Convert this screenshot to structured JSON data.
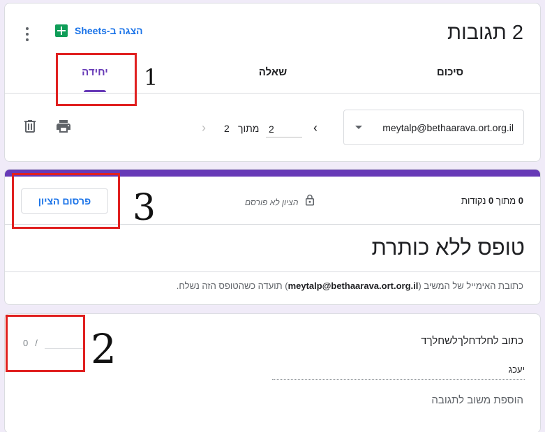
{
  "header": {
    "title": "2 תגובות",
    "sheets_link": "הצגה ב-Sheets"
  },
  "tabs": [
    {
      "label": "סיכום"
    },
    {
      "label": "שאלה"
    },
    {
      "label": "יחידה"
    }
  ],
  "respondent": {
    "email": "meytalp@bethaarava.ort.org.il"
  },
  "pager": {
    "current": "2",
    "of_label": "מתוך",
    "total": "2"
  },
  "form": {
    "points_prefix": "0",
    "points_mid": "מתוך",
    "points_total": "0",
    "points_suffix": "נקודות",
    "grade_status": "הציון לא פורסם",
    "publish_label": "פרסום הציון",
    "title": "טופס ללא כותרת",
    "email_note_prefix": "כתובת האימייל של המשיב (",
    "email_note_email": "meytalp@bethaarava.ort.org.il",
    "email_note_suffix": ") תועדה כשהטופס הזה נשלח."
  },
  "question": {
    "title": "כתוב לחלדחלךלשחלךד",
    "score_separator": "/",
    "score_max": "0",
    "answer": "יעכג",
    "feedback_label": "הוספת משוב לתגובה"
  },
  "annotations": {
    "mark_1": "1",
    "mark_2": "2",
    "mark_3": "3"
  },
  "colors": {
    "accent": "#673ab7",
    "link": "#1a73e8",
    "annotation": "#e02020",
    "background": "#f0ebf8"
  }
}
